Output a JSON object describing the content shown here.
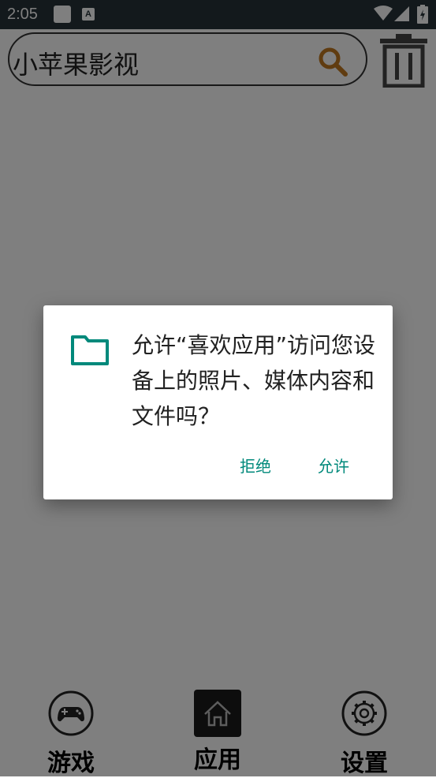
{
  "status_bar": {
    "time": "2:05",
    "notification_letter": "A"
  },
  "search": {
    "text": "小苹果影视"
  },
  "bottom_nav": {
    "games_label": "游戏",
    "apps_label": "应用",
    "settings_label": "设置"
  },
  "dialog": {
    "message": "允许“喜欢应用”访问您设备上的照片、媒体内容和文件吗？",
    "deny_label": "拒绝",
    "allow_label": "允许"
  },
  "colors": {
    "accent": "#00897b",
    "status_bar": "#263238"
  }
}
